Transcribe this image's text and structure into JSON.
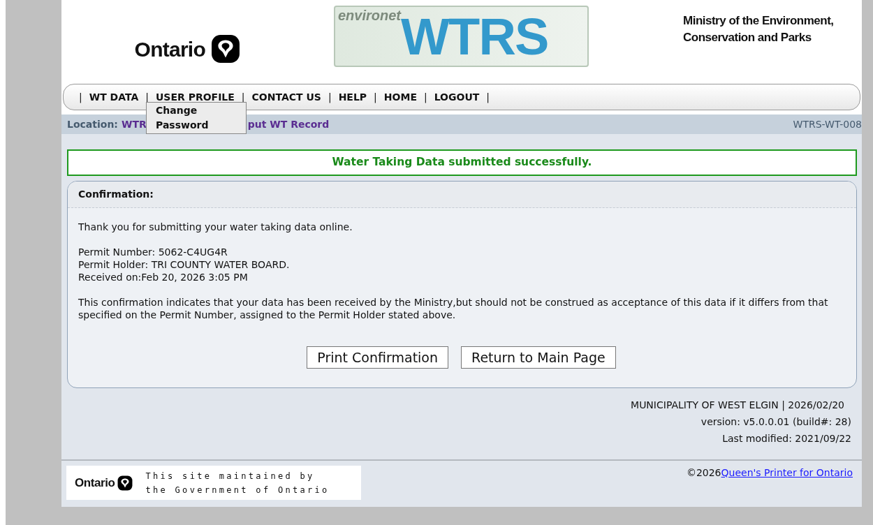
{
  "header": {
    "logo_text": "Ontario",
    "banner_small": "environet",
    "banner_large": "WTRS",
    "ministry": [
      "Ministry of the Environment,",
      "Conservation and Parks"
    ]
  },
  "nav": {
    "items": [
      {
        "label": "WT DATA"
      },
      {
        "label": "USER PROFILE"
      },
      {
        "label": "CONTACT US"
      },
      {
        "label": "HELP"
      },
      {
        "label": "HOME"
      },
      {
        "label": "LOGOUT"
      }
    ],
    "separator": "|",
    "dropdown": {
      "items": [
        "Change",
        "Password"
      ]
    }
  },
  "location": {
    "label": "Location:",
    "segments": [
      "WTR",
      "put WT Record"
    ],
    "page_code": "WTRS-WT-008"
  },
  "success_message": "Water Taking Data submitted successfully.",
  "confirmation": {
    "title": "Confirmation:",
    "thanks": "Thank you for submitting your water taking data online.",
    "details": [
      "Permit Number: 5062-C4UG4R",
      "Permit Holder: TRI COUNTY WATER BOARD.",
      "Received on:Feb 20, 2026 3:05 PM"
    ],
    "notice": "This confirmation indicates that your data has been received by the Ministry,but should not be construed as acceptance of this data if it differs from that specified on the Permit Number, assigned to the Permit Holder stated above.",
    "buttons": [
      "Print Confirmation",
      "Return to Main Page"
    ]
  },
  "info": [
    "MUNICIPALITY OF WEST ELGIN | 2026/02/20",
    "version: v5.0.0.01 (build#: 28)",
    "Last modified: 2021/09/22"
  ],
  "footer": {
    "logo_text": "Ontario",
    "maintained": [
      "This site maintained by",
      "the Government of Ontario"
    ],
    "copyright": "©2026",
    "link": "Queen's Printer for Ontario"
  }
}
